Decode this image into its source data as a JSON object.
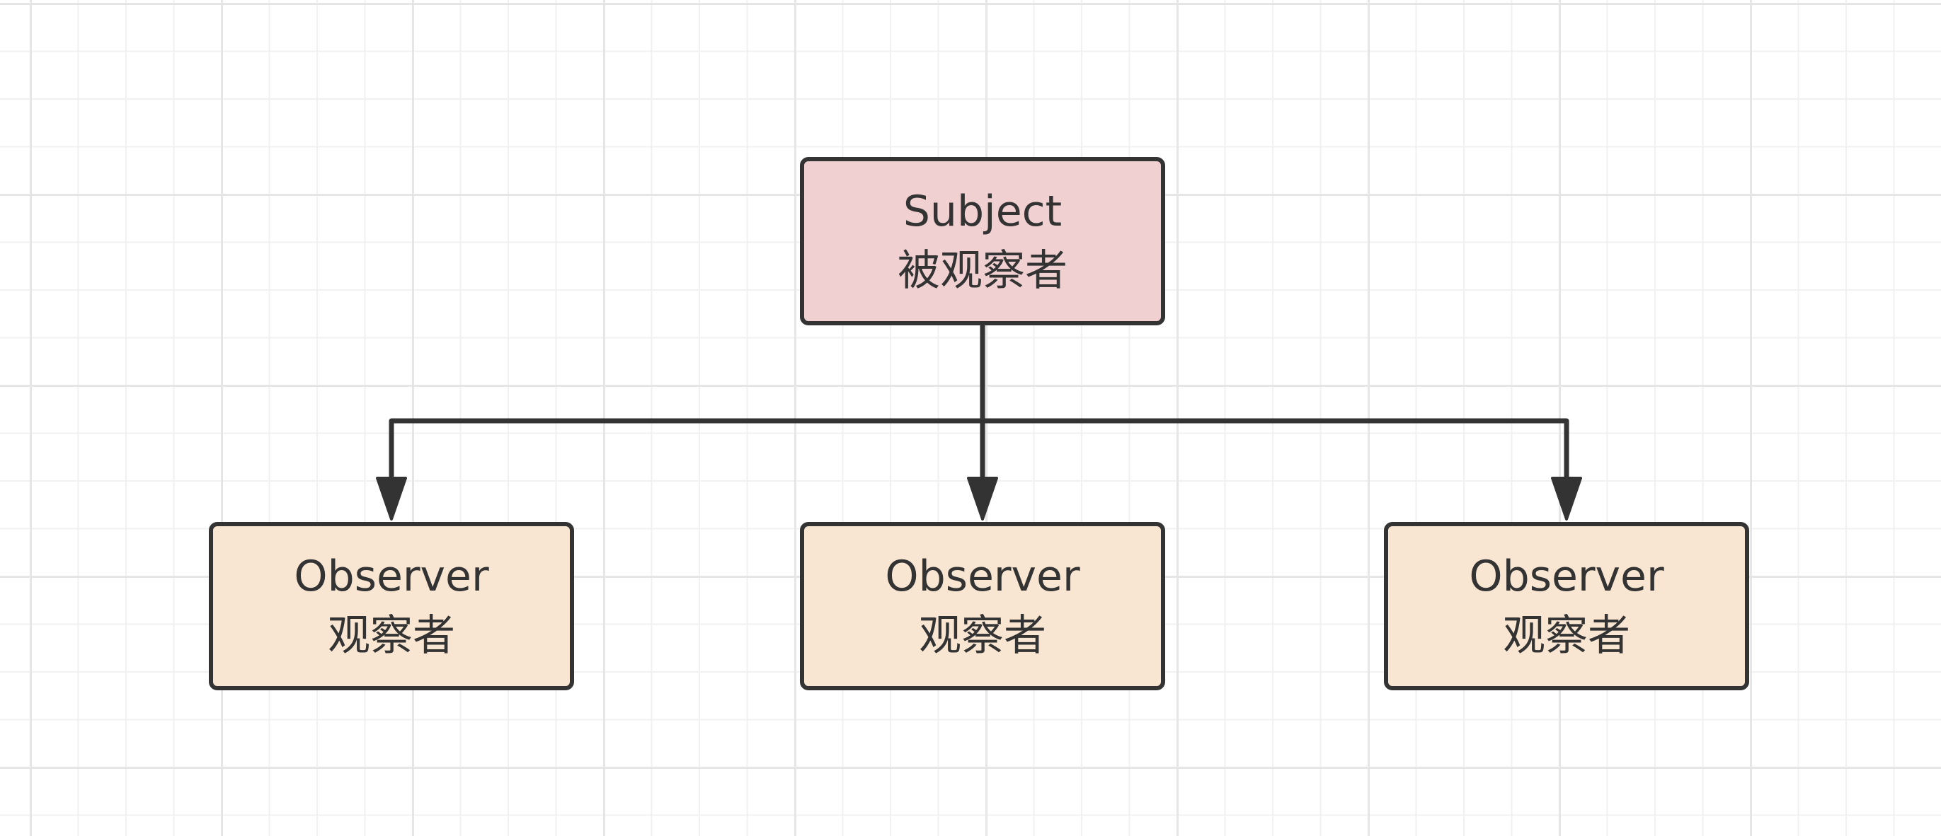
{
  "diagram": {
    "subject": {
      "line1": "Subject",
      "line2": "被观察者"
    },
    "observers": [
      {
        "line1": "Observer",
        "line2": "观察者"
      },
      {
        "line1": "Observer",
        "line2": "观察者"
      },
      {
        "line1": "Observer",
        "line2": "观察者"
      }
    ]
  },
  "colors": {
    "subject_fill": "#f0d0d0",
    "observer_fill": "#f9e6d2",
    "stroke": "#333333",
    "grid_major": "#e6e6e6",
    "grid_minor": "#f1f1f1"
  }
}
